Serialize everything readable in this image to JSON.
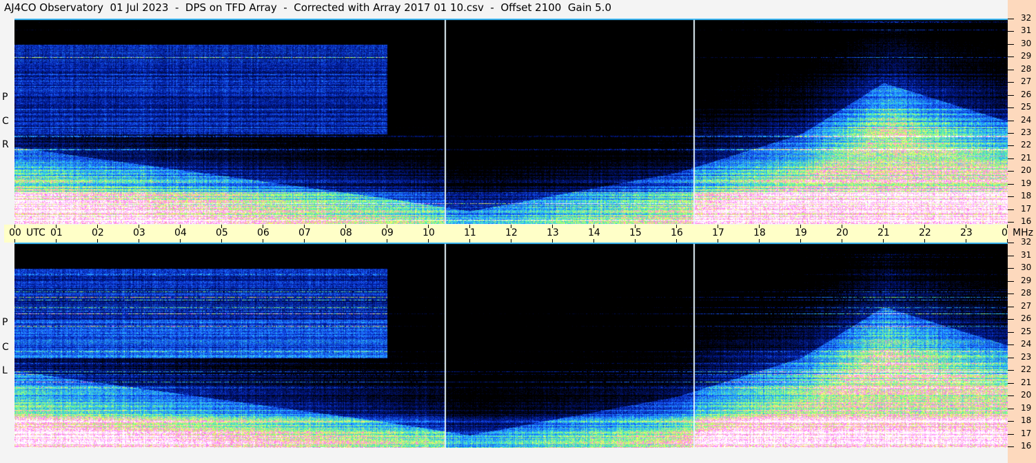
{
  "title": "AJ4CO Observatory  01 Jul 2023  -  DPS on TFD Array  -  Corrected with Array 2017 01 10.csv  -  Offset 2100  Gain 5.0",
  "chart_data": {
    "type": "heatmap",
    "title": "AJ4CO Observatory  01 Jul 2023  -  DPS on TFD Array  -  Corrected with Array 2017 01 10.csv  -  Offset 2100  Gain 5.0",
    "x_unit_label": "UTC",
    "y_unit_label": "MHz",
    "x_ticks": [
      "00",
      "01",
      "02",
      "03",
      "04",
      "05",
      "06",
      "07",
      "08",
      "09",
      "10",
      "11",
      "12",
      "13",
      "14",
      "15",
      "16",
      "17",
      "18",
      "19",
      "20",
      "21",
      "22",
      "23",
      "00"
    ],
    "y_ticks": [
      "16",
      "17",
      "18",
      "19",
      "20",
      "21",
      "22",
      "23",
      "24",
      "25",
      "26",
      "27",
      "28",
      "29",
      "30",
      "31",
      "32"
    ],
    "xlim": [
      0,
      24
    ],
    "ylim": [
      16,
      32
    ],
    "panels": [
      {
        "label_letters": [
          "R",
          "C",
          "P"
        ],
        "polarization": "RCP"
      },
      {
        "label_letters": [
          "L",
          "C",
          "P"
        ],
        "polarization": "LCP"
      }
    ],
    "vertical_markers_utc": [
      10.4,
      16.4
    ],
    "colormap": [
      "#000000",
      "#001a9c",
      "#1a5cff",
      "#28c8ff",
      "#7cff7c",
      "#ffff60",
      "#ff60ff",
      "#ffffff"
    ],
    "description_of_intensity": {
      "strong_low_freq_hours": [
        [
          0,
          10.4
        ],
        [
          16.4,
          24
        ]
      ],
      "weak_hours": [
        10.4,
        16.4
      ],
      "dayside_fill_upper_mhz": {
        "0": 22,
        "9": 18,
        "11": 17,
        "16": 20,
        "19": 23,
        "21": 27,
        "24": 24
      }
    }
  }
}
